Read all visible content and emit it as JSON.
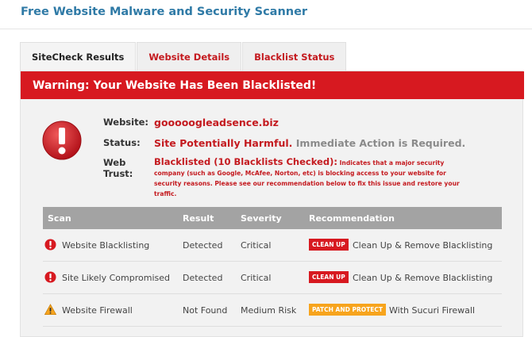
{
  "page": {
    "title": "Free Website Malware and Security Scanner"
  },
  "tabs": [
    {
      "label": "SiteCheck Results",
      "active": true
    },
    {
      "label": "Website Details",
      "active": false
    },
    {
      "label": "Blacklist Status",
      "active": false
    }
  ],
  "warning": {
    "text": "Warning: Your Website Has Been Blacklisted!",
    "color": "#d71920"
  },
  "info": {
    "website_label": "Website:",
    "website_value": "gooooogleadsence.biz",
    "status_label": "Status:",
    "status_value": "Site Potentially Harmful.",
    "status_note": "Immediate Action is Required.",
    "trust_label_1": "Web",
    "trust_label_2": "Trust:",
    "trust_lead": "Blacklisted (10 Blacklists Checked):",
    "trust_desc": "Indicates that a major security company (such as Google, McAfee, Norton, etc) is blocking access to your website for security reasons. Please see our recommendation below to fix this issue and restore your traffic."
  },
  "table": {
    "headers": {
      "scan": "Scan",
      "result": "Result",
      "severity": "Severity",
      "recommendation": "Recommendation"
    },
    "rows": [
      {
        "icon": "error-icon",
        "scan": "Website Blacklisting",
        "result": "Detected",
        "severity": "Critical",
        "badge": "CLEAN UP",
        "badge_color": "red",
        "recommendation": "Clean Up & Remove Blacklisting"
      },
      {
        "icon": "error-icon",
        "scan": "Site Likely Compromised",
        "result": "Detected",
        "severity": "Critical",
        "badge": "CLEAN UP",
        "badge_color": "red",
        "recommendation": "Clean Up & Remove Blacklisting"
      },
      {
        "icon": "warning-icon",
        "scan": "Website Firewall",
        "result": "Not Found",
        "severity": "Medium Risk",
        "badge": "PATCH AND PROTECT",
        "badge_color": "orange",
        "recommendation": "With Sucuri Firewall"
      }
    ]
  },
  "colors": {
    "brand_blue": "#2f7aa6",
    "alert_red": "#d71920",
    "header_gray": "#a3a3a3",
    "patch_orange": "#f7a41d"
  }
}
